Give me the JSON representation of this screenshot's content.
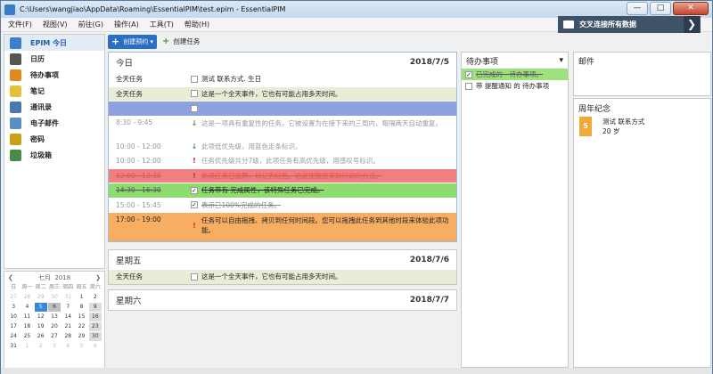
{
  "window": {
    "title": "C:\\Users\\wangjiao\\AppData\\Roaming\\EssentialPIM\\test.epim - EssentialPIM",
    "min": "—",
    "max": "□",
    "close": "✕"
  },
  "menu": [
    "文件(F)",
    "视图(V)",
    "前往(G)",
    "操作(A)",
    "工具(T)",
    "帮助(H)"
  ],
  "banner": {
    "text": "交叉连接所有数据",
    "arrow": "❯"
  },
  "sidebar": {
    "items": [
      {
        "label": "EPIM 今日",
        "icon": "home-icon",
        "color": "#3d7fcf"
      },
      {
        "label": "日历",
        "icon": "calendar-icon",
        "color": "#555555"
      },
      {
        "label": "待办事项",
        "icon": "todo-icon",
        "color": "#e08a1c"
      },
      {
        "label": "笔记",
        "icon": "notes-icon",
        "color": "#e3c23a"
      },
      {
        "label": "通讯录",
        "icon": "contacts-icon",
        "color": "#4a78b0"
      },
      {
        "label": "电子邮件",
        "icon": "mail-icon",
        "color": "#5a8fc4"
      },
      {
        "label": "密码",
        "icon": "key-icon",
        "color": "#caa018"
      },
      {
        "label": "垃圾箱",
        "icon": "trash-icon",
        "color": "#4c8a4a"
      }
    ]
  },
  "minical": {
    "prev": "❮",
    "next": "❯",
    "month": "七月",
    "year": "2018",
    "weekdays": [
      "日",
      "周一",
      "周二",
      "周三",
      "周四",
      "周五",
      "周六"
    ],
    "days": [
      "27",
      "28",
      "29",
      "30",
      "31",
      "1",
      "2",
      "3",
      "4",
      "5",
      "6",
      "7",
      "8",
      "9",
      "10",
      "11",
      "12",
      "13",
      "14",
      "15",
      "16",
      "17",
      "18",
      "19",
      "20",
      "21",
      "22",
      "23",
      "24",
      "25",
      "26",
      "27",
      "28",
      "29",
      "30",
      "31",
      "1",
      "2",
      "3",
      "4",
      "5",
      "6"
    ]
  },
  "toolbar": {
    "new_appt": "创建预约",
    "new_task": "创建任务"
  },
  "today": {
    "title": "今日",
    "date": "2018/7/5",
    "rows": [
      {
        "time": "全天任务",
        "text": "测试 联系方式. 生日",
        "style": "allday-plain",
        "mark": "checkbox"
      },
      {
        "time": "全天任务",
        "text": "这是一个全天事件，它也有可能占用多天时间。",
        "style": "allday",
        "mark": "checkbox"
      },
      {
        "time": "",
        "text": "",
        "style": "blue",
        "mark": "checkbox"
      },
      {
        "time": "8:30 - 9:45",
        "text": "这是一项具有重复性的任务。它被设置为在接下来的三周内，每隔两天自动重复。",
        "style": "plain",
        "mark": "down"
      },
      {
        "time": "10:00 - 12:00",
        "text": "此项低优先级，用蓝色走条标识。",
        "style": "plain",
        "mark": "down"
      },
      {
        "time": "10:00 - 12:00",
        "text": "任务优先级共分7级，此项任务有高优先级，用感叹号标识。",
        "style": "plain",
        "mark": "bang"
      },
      {
        "time": "12:00 - 13:30",
        "text": "此项任务已逾期，标记为红色。这是提醒您采取行动的方式。",
        "style": "red",
        "mark": "bang"
      },
      {
        "time": "14:30 - 16:30",
        "text": "任务带有 完成属性，该特殊任务已完成。",
        "style": "green",
        "mark": "checked"
      },
      {
        "time": "15:00 - 15:45",
        "text": "表示已100%完成的任务。",
        "style": "plain-done",
        "mark": "checked"
      },
      {
        "time": "17:00 - 19:00",
        "text": "任务可以自由拖拽、拷贝到任何时间段。您可以拖拽此任务到其他时段来体验此项功能。",
        "style": "orange",
        "mark": "bang"
      }
    ]
  },
  "friday": {
    "title": "星期五",
    "date": "2018/7/6",
    "rows": [
      {
        "time": "全天任务",
        "text": "这是一个全天事件，它也有可能占用多天时间。"
      }
    ]
  },
  "saturday": {
    "title": "星期六",
    "date": "2018/7/7"
  },
  "todo": {
    "title": "待办事项",
    "dropdown": "▾",
    "items": [
      {
        "text": "已完成的 - 待办事项。",
        "checked": true
      },
      {
        "text": "带 提醒通知 的 待办事项",
        "checked": false
      }
    ]
  },
  "mail": {
    "title": "邮件"
  },
  "anniv": {
    "title": "周年纪念",
    "name": "测试 联系方式",
    "age": "20 岁",
    "badge": "5"
  },
  "colors": {
    "allday": "#e8edd7",
    "blue": "#8fa2e0",
    "red": "#f07f7f",
    "green": "#8fdc6e",
    "orange": "#f7ae63"
  }
}
